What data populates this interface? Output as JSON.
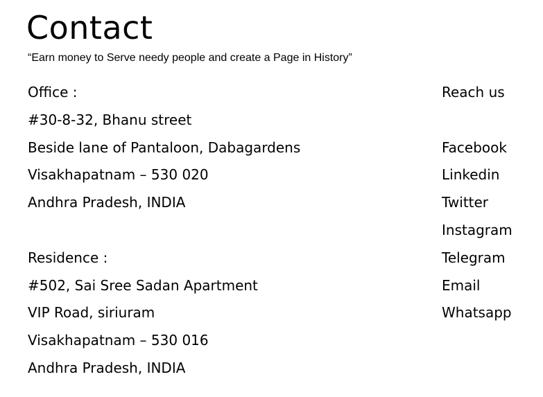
{
  "page": {
    "title": "Contact",
    "tagline": "“Earn money to Serve needy people and create a Page in History”"
  },
  "office": {
    "heading": "Office :",
    "address": [
      "#30-8-32, Bhanu street",
      "Beside lane of Pantaloon, Dabagardens",
      "Visakhapatnam – 530 020",
      "Andhra Pradesh, INDIA"
    ]
  },
  "residence": {
    "heading": "Residence :",
    "address": [
      "#502, Sai Sree Sadan Apartment",
      "VIP Road, siriuram",
      "Visakhapatnam – 530 016",
      "Andhra Pradesh, INDIA"
    ]
  },
  "reach": {
    "heading": "Reach us",
    "links": [
      "Facebook",
      "Linkedin",
      "Twitter",
      "Instagram",
      "Telegram",
      "Email",
      "Whatsapp"
    ]
  }
}
